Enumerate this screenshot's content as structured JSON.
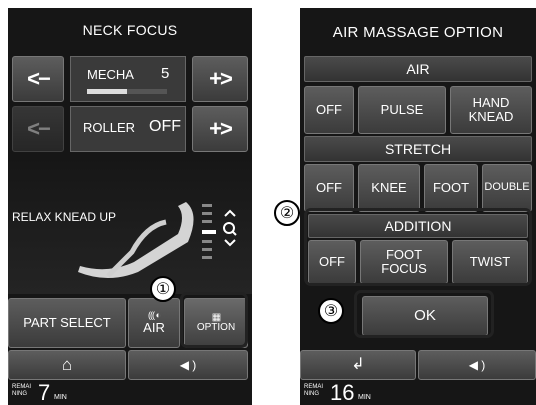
{
  "left_panel": {
    "title": "NECK FOCUS",
    "mecha": {
      "label": "MECHA",
      "value": "5",
      "level_fraction": 0.5,
      "minus": "<−",
      "plus": "+>"
    },
    "roller": {
      "label": "ROLLER",
      "value": "OFF",
      "minus": "<−",
      "plus": "+>"
    },
    "status_text": "RELAX KNEAD UP",
    "part_select": "PART SELECT",
    "air_label": "AIR",
    "option_label": "OPTION",
    "remain_label": "REMAI\nNING",
    "remain_value": "7",
    "remain_unit": "MIN"
  },
  "right_panel": {
    "title": "AIR MASSAGE OPTION",
    "air": {
      "heading": "AIR",
      "options": [
        "OFF",
        "PULSE",
        "HAND\nKNEAD"
      ]
    },
    "stretch": {
      "heading": "STRETCH",
      "options": [
        "OFF",
        "KNEE",
        "FOOT",
        "DOUBLE"
      ]
    },
    "addition": {
      "heading": "ADDITION",
      "options": [
        "OFF",
        "FOOT\nFOCUS",
        "TWIST"
      ]
    },
    "ok_label": "OK",
    "remain_label": "REMAI\nNING",
    "remain_value": "16",
    "remain_unit": "MIN"
  },
  "callouts": [
    "①",
    "②",
    "③"
  ],
  "icons": [
    "home-icon",
    "speaker-icon",
    "back-arrow-icon",
    "air-waves-icon",
    "option-grid-icon",
    "massage-chair-figure"
  ]
}
